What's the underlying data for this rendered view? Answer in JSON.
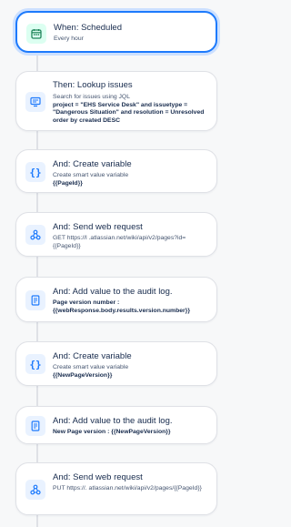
{
  "rules": [
    {
      "title": "When: Scheduled",
      "sub": "Every hour"
    },
    {
      "title": "Then: Lookup issues",
      "sub": "Search for issues using JQL",
      "bold": "project = \"EHS Service Desk\" and issuetype = \"Dangerous Situation\" and resolution = Unresolved order by created DESC"
    },
    {
      "title": "And: Create variable",
      "sub": "Create smart value variable",
      "bold": "{{PageId}}"
    },
    {
      "title": "And: Send web request",
      "sub": "GET https://l          .atlassian.net/wiki/api/v2/pages?id={{PageId}}"
    },
    {
      "title": "And: Add value to the audit log.",
      "bold1": "Page version number :",
      "bold": "{{webResponse.body.results.version.number}}"
    },
    {
      "title": "And: Create variable",
      "sub": "Create smart value variable",
      "bold": "{{NewPageVersion}}"
    },
    {
      "title": "And: Add value to the audit log.",
      "bold": "New Page version : {{NewPageVersion}}"
    },
    {
      "title": "And: Send web request",
      "sub": "PUT https://.          atlassian.net/wiki/api/v2/pages/{{PageId}}"
    }
  ],
  "colors": {
    "accent": "#1d7afc",
    "trigger_icon_bg": "#dcfff1",
    "action_icon_bg": "#e9f2ff"
  },
  "icons": [
    "calendar-icon",
    "search-issues-icon",
    "variable-braces-icon",
    "webhook-icon",
    "audit-log-icon",
    "variable-braces-icon",
    "audit-log-icon",
    "webhook-icon"
  ]
}
